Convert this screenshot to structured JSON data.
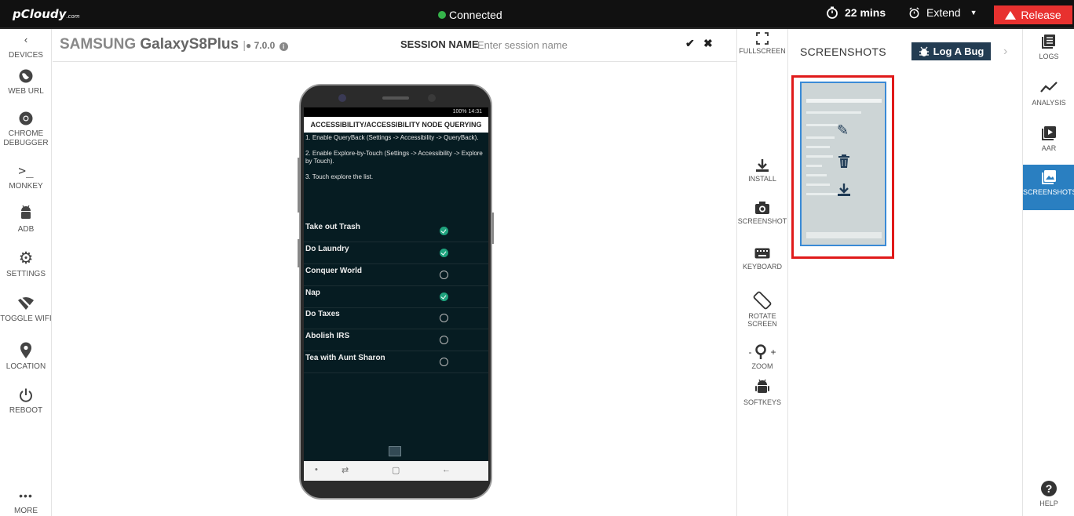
{
  "topbar": {
    "logo": "pCloudy",
    "logo_suffix": ".com",
    "status": "Connected",
    "timer": "22 mins",
    "extend_label": "Extend",
    "release_label": "Release"
  },
  "left_sidebar": {
    "items": [
      {
        "label": "DEVICES",
        "icon": "chevron-left-icon"
      },
      {
        "label": "WEB URL",
        "icon": "globe-icon"
      },
      {
        "label": "CHROME",
        "label2": "DEBUGGER",
        "icon": "chrome-icon"
      },
      {
        "label": "MONKEY",
        "icon": "terminal-icon"
      },
      {
        "label": "ADB",
        "icon": "android-icon"
      },
      {
        "label": "SETTINGS",
        "icon": "gear-icon"
      },
      {
        "label": "TOGGLE WIFI",
        "icon": "wifi-off-icon"
      },
      {
        "label": "LOCATION",
        "icon": "location-pin-icon"
      },
      {
        "label": "REBOOT",
        "icon": "power-icon"
      },
      {
        "label": "MORE",
        "icon": "more-dots-icon"
      }
    ]
  },
  "device": {
    "brand": "SAMSUNG",
    "model": "GalaxyS8Plus",
    "separator": "|",
    "os_version": "7.0.0"
  },
  "session": {
    "label": "SESSION NAME",
    "placeholder": "Enter session name"
  },
  "phone_screen": {
    "status_text": "100% 14:31",
    "app_title": "ACCESSIBILITY/ACCESSIBILITY NODE QUERYING",
    "instructions": [
      "1. Enable QueryBack (Settings -> Accessibility -> QueryBack).",
      "2. Enable Explore-by-Touch (Settings -> Accessibility -> Explore by Touch).",
      "3. Touch explore the list."
    ],
    "tasks": [
      {
        "label": "Take out Trash",
        "done": true
      },
      {
        "label": "Do Laundry",
        "done": true
      },
      {
        "label": "Conquer World",
        "done": false
      },
      {
        "label": "Nap",
        "done": true
      },
      {
        "label": "Do Taxes",
        "done": false
      },
      {
        "label": "Abolish IRS",
        "done": false
      },
      {
        "label": "Tea with Aunt Sharon",
        "done": false
      }
    ]
  },
  "tools": {
    "fullscreen": "FULLSCREEN",
    "install": "INSTALL",
    "screenshot": "SCREENSHOT",
    "keyboard": "KEYBOARD",
    "rotate_line1": "ROTATE",
    "rotate_line2": "SCREEN",
    "zoom": "ZOOM",
    "zoom_minus": "-",
    "zoom_plus": "+",
    "softkeys": "SOFTKEYS"
  },
  "screenshots_panel": {
    "title": "SCREENSHOTS",
    "log_bug_label": "Log A Bug"
  },
  "right_sidebar": {
    "items": [
      {
        "label": "LOGS",
        "icon": "logs-icon",
        "active": false
      },
      {
        "label": "ANALYSIS",
        "icon": "analysis-icon",
        "active": false
      },
      {
        "label": "AAR",
        "icon": "video-icon",
        "active": false
      },
      {
        "label": "SCREENSHOTS",
        "icon": "image-icon",
        "active": true
      },
      {
        "label": "HELP",
        "icon": "help-icon",
        "active": false
      }
    ]
  },
  "colors": {
    "topbar_bg": "#111111",
    "connected_dot": "#35b34a",
    "release_bg": "#e8312f",
    "log_bug_bg": "#233c52",
    "active_tab_bg": "#2a7fc1",
    "highlight_border": "#e01a1a",
    "phone_screen_bg": "#061c22",
    "check_on": "#1fa37e"
  }
}
